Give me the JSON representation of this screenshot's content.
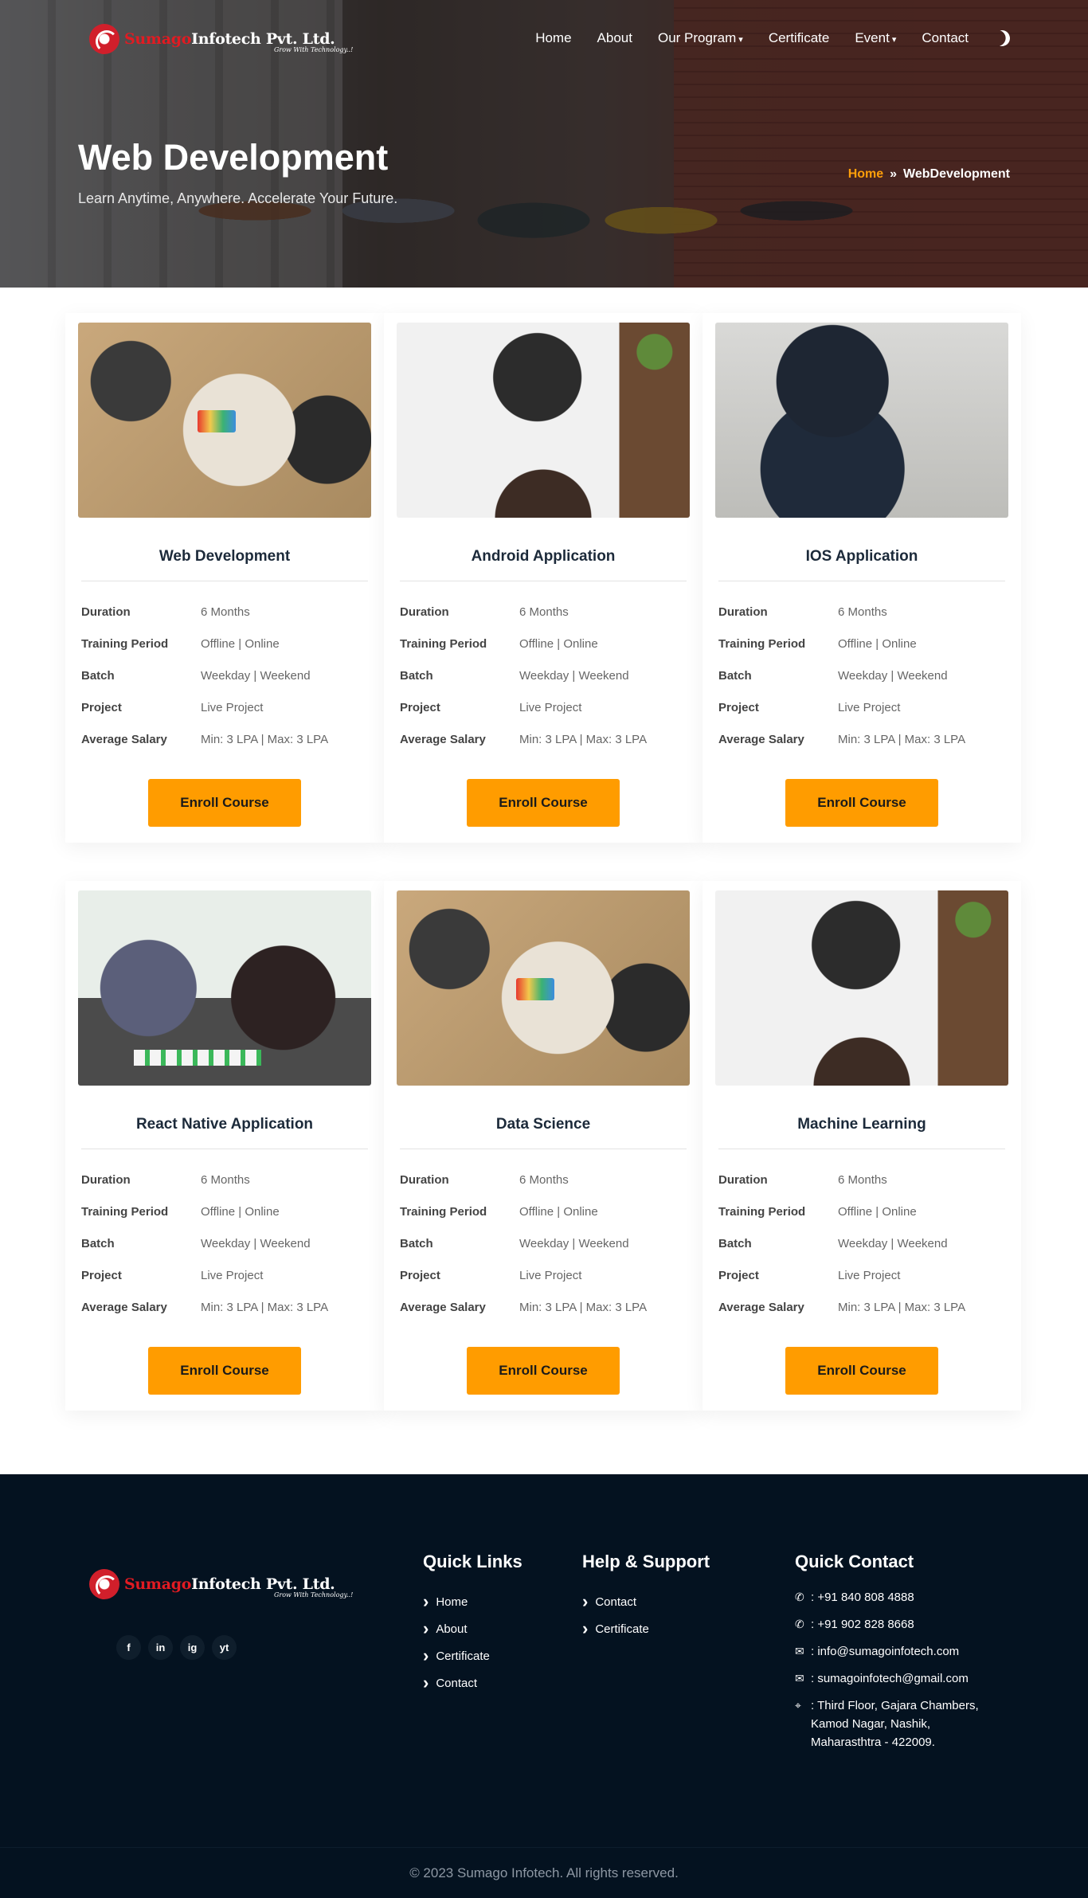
{
  "brand": {
    "name_red": "Sumago",
    "name_white": "Infotech Pvt. Ltd.",
    "tagline": "Grow With Technology..!"
  },
  "nav": {
    "home": "Home",
    "about": "About",
    "program": "Our Program",
    "certificate": "Certificate",
    "event": "Event",
    "contact": "Contact",
    "theme_icon": "moon-icon"
  },
  "hero": {
    "title": "Web Development",
    "subtitle": "Learn Anytime, Anywhere. Accelerate Your Future.",
    "breadcrumb_home": "Home",
    "breadcrumb_separator": "»",
    "breadcrumb_current": "WebDevelopment"
  },
  "labels": {
    "duration": "Duration",
    "training_period": "Training Period",
    "batch": "Batch",
    "project": "Project",
    "average_salary": "Average Salary",
    "enroll": "Enroll Course"
  },
  "courses": [
    {
      "title": "Web Development",
      "duration": "6 Months",
      "training_period": "Offline | Online",
      "batch": "Weekday | Weekend",
      "project": "Live Project",
      "salary": "Min: 3 LPA | Max: 3 LPA"
    },
    {
      "title": "Android Application",
      "duration": "6 Months",
      "training_period": "Offline | Online",
      "batch": "Weekday | Weekend",
      "project": "Live Project",
      "salary": "Min: 3 LPA | Max: 3 LPA"
    },
    {
      "title": "IOS Application",
      "duration": "6 Months",
      "training_period": "Offline | Online",
      "batch": "Weekday | Weekend",
      "project": "Live Project",
      "salary": "Min: 3 LPA | Max: 3 LPA"
    },
    {
      "title": "React Native Application",
      "duration": "6 Months",
      "training_period": "Offline | Online",
      "batch": "Weekday | Weekend",
      "project": "Live Project",
      "salary": "Min: 3 LPA | Max: 3 LPA"
    },
    {
      "title": "Data Science",
      "duration": "6 Months",
      "training_period": "Offline | Online",
      "batch": "Weekday | Weekend",
      "project": "Live Project",
      "salary": "Min: 3 LPA | Max: 3 LPA"
    },
    {
      "title": "Machine Learning",
      "duration": "6 Months",
      "training_period": "Offline | Online",
      "batch": "Weekday | Weekend",
      "project": "Live Project",
      "salary": "Min: 3 LPA | Max: 3 LPA"
    }
  ],
  "footer": {
    "socials": [
      "f",
      "in",
      "ig",
      "yt"
    ],
    "quick_links": {
      "title": "Quick Links",
      "items": [
        "Home",
        "About",
        "Certificate",
        "Contact"
      ]
    },
    "help": {
      "title": "Help & Support",
      "items": [
        "Contact",
        "Certificate"
      ]
    },
    "contact": {
      "title": "Quick Contact",
      "phone1": ": +91 840 808 4888",
      "phone2": ": +91 902 828 8668",
      "email1": ": info@sumagoinfotech.com",
      "email2": ": sumagoinfotech@gmail.com",
      "address": ": Third Floor, Gajara Chambers, Kamod Nagar, Nashik, Maharasthtra - 422009."
    },
    "copyright": "© 2023 Sumago Infotech. All rights reserved."
  },
  "colors": {
    "accent": "#ff9c00",
    "footer_bg": "#041220",
    "brand_red": "#e11b22"
  }
}
